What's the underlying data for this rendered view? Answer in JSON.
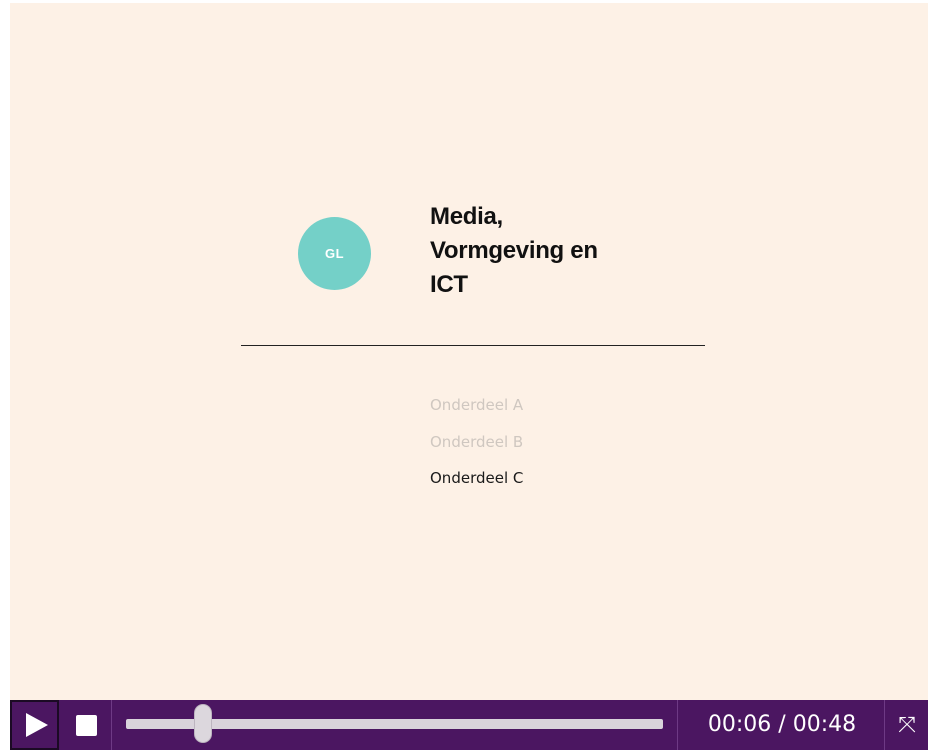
{
  "slide": {
    "logo_text": "GL",
    "title_lines": [
      "Media,",
      "Vormgeving en",
      "ICT"
    ],
    "parts": [
      {
        "label": "Onderdeel A",
        "active": false
      },
      {
        "label": "Onderdeel B",
        "active": false
      },
      {
        "label": "Onderdeel C",
        "active": true
      }
    ]
  },
  "player": {
    "current_time": "00:06",
    "duration": "00:48",
    "time_separator": " / ",
    "progress_fraction": 0.143,
    "play_icon": "play-icon",
    "stop_icon": "stop-icon",
    "fullscreen_icon": "fullscreen-icon",
    "colors": {
      "stage_bg": "#fdf1e6",
      "bar_bg": "#4b1661",
      "logo_bg": "#74d0c8"
    }
  }
}
